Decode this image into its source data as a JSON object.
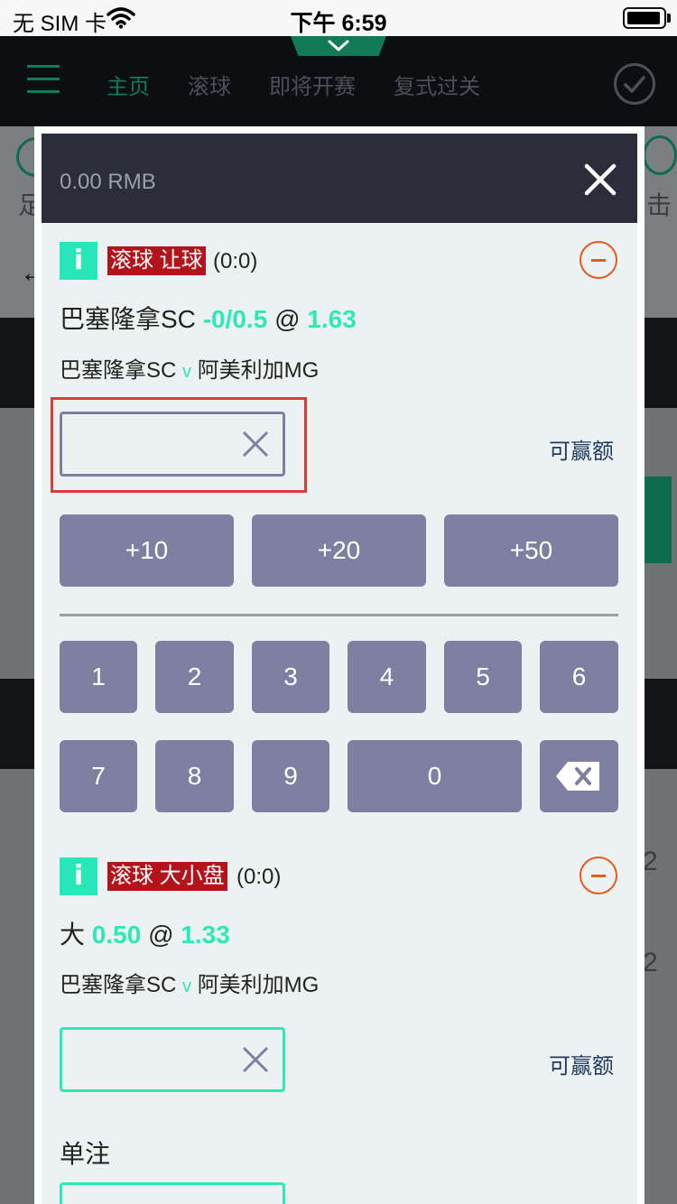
{
  "status_bar": {
    "carrier": "无 SIM 卡",
    "time": "下午 6:59"
  },
  "nav": {
    "items": [
      "主页",
      "滚球",
      "即将开赛",
      "复式过关"
    ],
    "active_index": 0
  },
  "background": {
    "left_glyph": "足",
    "right_glyph": "击",
    "right_digit_1": "2",
    "right_digit_2": "2"
  },
  "bet_slip": {
    "balance": "0.00 RMB",
    "payout_label": "可赢额",
    "quick_stakes": [
      "+10",
      "+20",
      "+50"
    ],
    "keypad": [
      "1",
      "2",
      "3",
      "4",
      "5",
      "6",
      "7",
      "8",
      "9",
      "0"
    ],
    "single_label": "单注",
    "bets": [
      {
        "info": "i",
        "market": "滚球 让球",
        "score": "(0:0)",
        "team": "巴塞隆拿SC",
        "line": "-0/0.5",
        "at": "@",
        "odds": "1.63",
        "home": "巴塞隆拿SC",
        "versus": "v",
        "away": "阿美利加MG",
        "stake_value": ""
      },
      {
        "info": "i",
        "market": "滚球 大小盘",
        "score": "(0:0)",
        "team": "大",
        "line": "0.50",
        "at": "@",
        "odds": "1.33",
        "home": "巴塞隆拿SC",
        "versus": "v",
        "away": "阿美利加MG",
        "stake_value": ""
      }
    ]
  },
  "colors": {
    "accent": "#2ee8b6",
    "header_bg": "#2b2d3a",
    "key_bg": "#7d80a1",
    "market_tag": "#b3141b",
    "remove": "#e7591c",
    "highlight": "#e03a34"
  }
}
